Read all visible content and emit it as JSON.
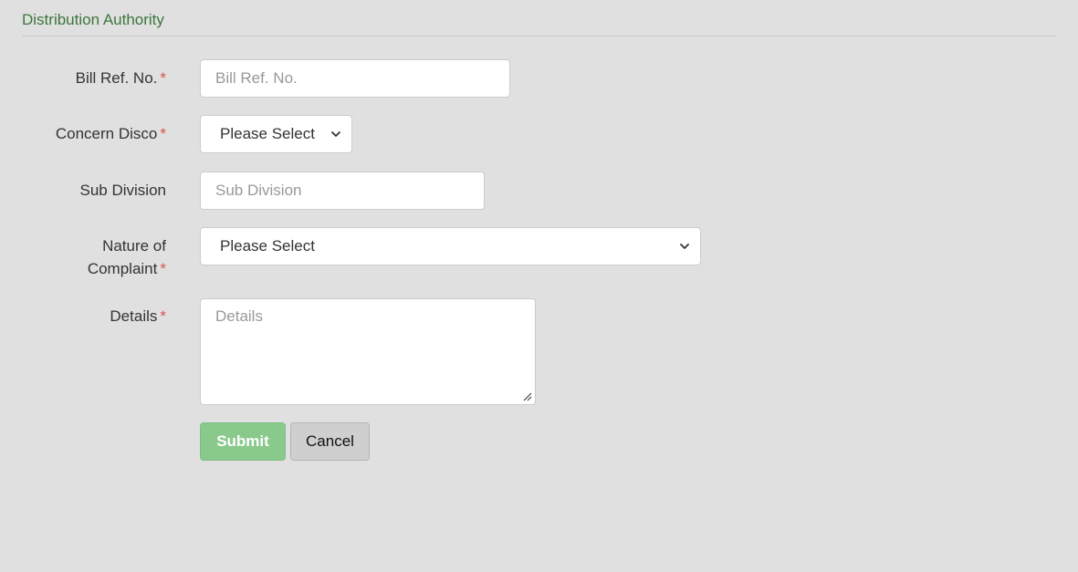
{
  "section": {
    "title": "Distribution Authority"
  },
  "form": {
    "bill_ref": {
      "label": "Bill Ref. No.",
      "required_mark": "*",
      "placeholder": "Bill Ref. No.",
      "value": ""
    },
    "concern_disco": {
      "label": "Concern Disco",
      "required_mark": "*",
      "selected": "Please Select"
    },
    "sub_division": {
      "label": "Sub Division",
      "placeholder": "Sub Division",
      "value": ""
    },
    "nature_of_complaint": {
      "label": "Nature of Complaint",
      "required_mark": "*",
      "selected": "Please Select"
    },
    "details": {
      "label": "Details",
      "required_mark": "*",
      "placeholder": "Details",
      "value": ""
    }
  },
  "actions": {
    "submit_label": "Submit",
    "cancel_label": "Cancel"
  },
  "icons": {
    "select_arrow": "chevron-down-icon",
    "textarea_resize": "resize-grip-icon"
  },
  "colors": {
    "page_background": "#e0e0e0",
    "section_title": "#3c763d",
    "required_mark": "#d9534f",
    "submit_button": "#8ac98c",
    "cancel_button": "#cfcfcf"
  }
}
